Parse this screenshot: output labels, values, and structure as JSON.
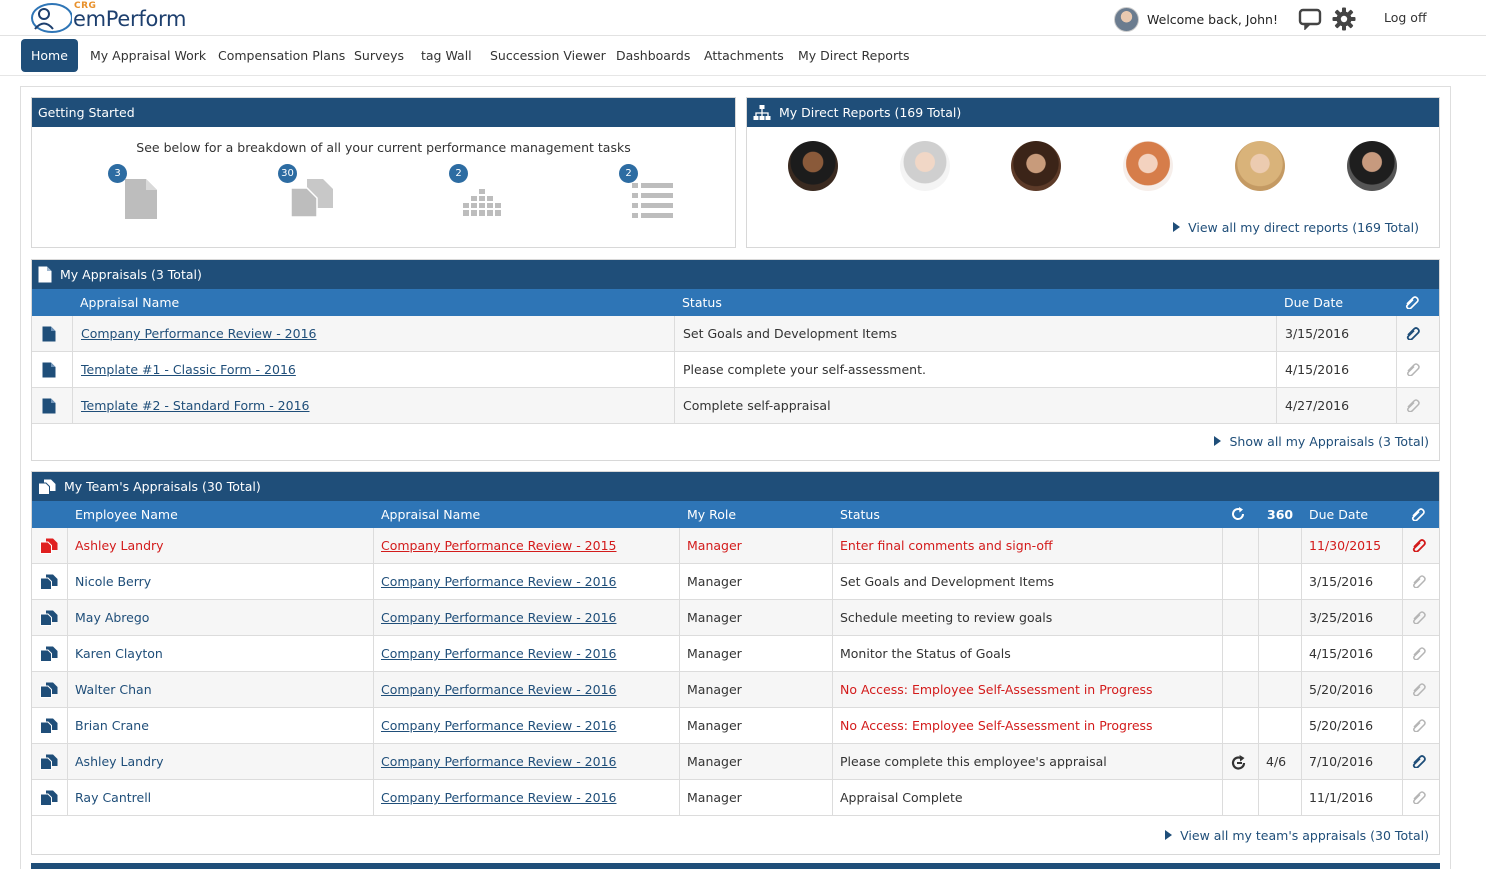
{
  "header": {
    "logo_small": "CRG",
    "logo_text": "emPerform",
    "welcome": "Welcome back, John!",
    "logoff": "Log off"
  },
  "nav": [
    {
      "label": "Home",
      "active": true
    },
    {
      "label": "My Appraisal Work"
    },
    {
      "label": "Compensation Plans"
    },
    {
      "label": "Surveys"
    },
    {
      "label": "tag Wall"
    },
    {
      "label": "Succession Viewer"
    },
    {
      "label": "Dashboards"
    },
    {
      "label": "Attachments"
    },
    {
      "label": "My Direct Reports"
    }
  ],
  "getting_started": {
    "title": "Getting Started",
    "subtitle": "See below for a breakdown of all your current performance management tasks",
    "items": [
      {
        "icon": "document-icon",
        "count": "3"
      },
      {
        "icon": "documents-icon",
        "count": "30"
      },
      {
        "icon": "survey-icon",
        "count": "2"
      },
      {
        "icon": "list-icon",
        "count": "2"
      }
    ]
  },
  "direct_reports": {
    "title": "My Direct Reports (169 Total)",
    "view_all": "View all my direct reports (169 Total)"
  },
  "my_appraisals": {
    "title": "My Appraisals (3 Total)",
    "columns": {
      "name": "Appraisal Name",
      "status": "Status",
      "due": "Due Date"
    },
    "rows": [
      {
        "name": "Company Performance Review - 2016",
        "status": "Set Goals and Development Items",
        "due": "3/15/2016",
        "attach": true
      },
      {
        "name": "Template #1 - Classic Form - 2016",
        "status": "Please complete your self-assessment.",
        "due": "4/15/2016",
        "attach": false
      },
      {
        "name": "Template #2 - Standard Form - 2016",
        "status": "Complete self-appraisal",
        "due": "4/27/2016",
        "attach": false
      }
    ],
    "show_all": "Show all my Appraisals (3 Total)"
  },
  "team_appraisals": {
    "title": "My Team's Appraisals (30 Total)",
    "columns": {
      "employee": "Employee Name",
      "appraisal": "Appraisal Name",
      "role": "My Role",
      "status": "Status",
      "c360": "360",
      "due": "Due Date"
    },
    "rows": [
      {
        "employee": "Ashley Landry",
        "appraisal": "Company Performance Review - 2015",
        "role": "Manager",
        "status": "Enter final comments and sign-off",
        "refresh": "",
        "r360": "",
        "due": "11/30/2015",
        "overdue": true,
        "status_red": true,
        "attach": true
      },
      {
        "employee": "Nicole Berry",
        "appraisal": "Company Performance Review - 2016",
        "role": "Manager",
        "status": "Set Goals and Development Items",
        "refresh": "",
        "r360": "",
        "due": "3/15/2016",
        "overdue": false,
        "status_red": false,
        "attach": false
      },
      {
        "employee": "May Abrego",
        "appraisal": "Company Performance Review - 2016",
        "role": "Manager",
        "status": "Schedule meeting to review goals",
        "refresh": "",
        "r360": "",
        "due": "3/25/2016",
        "overdue": false,
        "status_red": false,
        "attach": false
      },
      {
        "employee": "Karen Clayton",
        "appraisal": "Company Performance Review - 2016",
        "role": "Manager",
        "status": "Monitor the Status of Goals",
        "refresh": "",
        "r360": "",
        "due": "4/15/2016",
        "overdue": false,
        "status_red": false,
        "attach": false
      },
      {
        "employee": "Walter Chan",
        "appraisal": "Company Performance Review - 2016",
        "role": "Manager",
        "status": "No Access: Employee Self-Assessment in Progress",
        "refresh": "",
        "r360": "",
        "due": "5/20/2016",
        "overdue": false,
        "status_red": true,
        "attach": false
      },
      {
        "employee": "Brian Crane",
        "appraisal": "Company Performance Review - 2016",
        "role": "Manager",
        "status": "No Access: Employee Self-Assessment in Progress",
        "refresh": "",
        "r360": "",
        "due": "5/20/2016",
        "overdue": false,
        "status_red": true,
        "attach": false
      },
      {
        "employee": "Ashley Landry",
        "appraisal": "Company Performance Review - 2016",
        "role": "Manager",
        "status": "Please complete this employee's appraisal",
        "refresh": "refresh-icon",
        "r360": "4/6",
        "due": "7/10/2016",
        "overdue": false,
        "status_red": false,
        "attach": true
      },
      {
        "employee": "Ray Cantrell",
        "appraisal": "Company Performance Review - 2016",
        "role": "Manager",
        "status": "Appraisal Complete",
        "refresh": "",
        "r360": "",
        "due": "11/1/2016",
        "overdue": false,
        "status_red": false,
        "attach": false
      }
    ],
    "view_all": "View all my team's appraisals (30 Total)"
  },
  "colors": {
    "primary": "#1f4e79",
    "subheader": "#2e75b6",
    "alert": "#d31b1b",
    "badge": "#2d6ca2"
  }
}
